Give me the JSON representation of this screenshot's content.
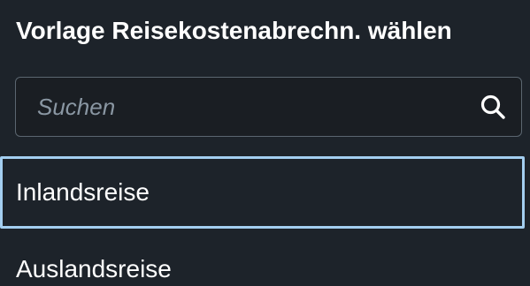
{
  "dialog": {
    "title": "Vorlage Reisekostenabrechn. wählen"
  },
  "search": {
    "placeholder": "Suchen",
    "value": "",
    "icon": "search-icon"
  },
  "templates": {
    "items": [
      {
        "label": "Inlandsreise",
        "selected": true
      },
      {
        "label": "Auslandsreise",
        "selected": false
      }
    ]
  },
  "colors": {
    "background": "#1d232a",
    "field_border": "#5b6670",
    "focus_border": "#a3cef0",
    "placeholder": "#8a97a3",
    "text": "#ffffff"
  }
}
